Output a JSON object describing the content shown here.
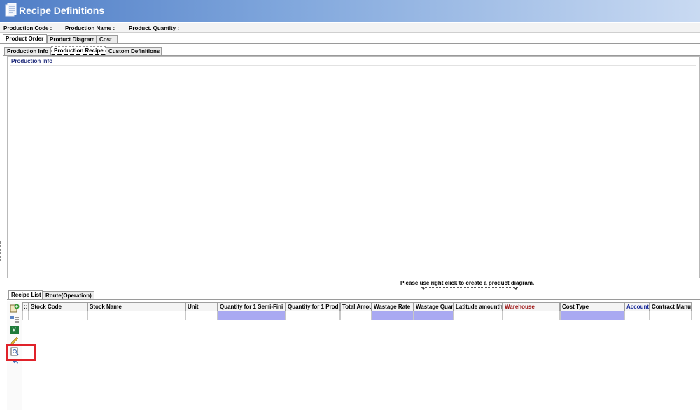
{
  "window": {
    "title": "Recipe Definitions"
  },
  "info_bar": {
    "production_code_label": "Production Code :",
    "production_name_label": "Production Name :",
    "production_quantity_label": "Product. Quantity :"
  },
  "main_tabs": [
    {
      "label": "Product Order",
      "active": true
    },
    {
      "label": "Product Diagram",
      "active": false
    },
    {
      "label": "Cost",
      "active": false
    }
  ],
  "sub_tabs": [
    {
      "label": "Production Info",
      "active": false
    },
    {
      "label": "Production Recipe",
      "active": true
    },
    {
      "label": "Custom Definitions",
      "active": false
    }
  ],
  "production_info": {
    "legend": "Production Info"
  },
  "diagram_hint": "Please use right click to create a product diagram.",
  "recipe_tabs": [
    {
      "label": "Recipe List",
      "active": true
    },
    {
      "label": "Route(Operation)",
      "active": false
    }
  ],
  "toolbar_icons": [
    "add-row-icon",
    "insert-row-icon",
    "excel-export-icon",
    "edit-icon",
    "search-document-icon",
    "undo-icon"
  ],
  "grid": {
    "row_header": "::",
    "columns": [
      {
        "label": "Stock Code",
        "style": "normal",
        "required": false
      },
      {
        "label": "Stock Name",
        "style": "normal",
        "required": false
      },
      {
        "label": "Unit",
        "style": "normal",
        "required": false
      },
      {
        "label": "Quantity for 1 Semi-Fini",
        "style": "normal",
        "required": true
      },
      {
        "label": "Quantity for 1 Prod",
        "style": "normal",
        "required": false
      },
      {
        "label": "Total Amou",
        "style": "normal",
        "required": false
      },
      {
        "label": "Wastage Rate",
        "style": "normal",
        "required": true
      },
      {
        "label": "Wastage Quar",
        "style": "normal",
        "required": true
      },
      {
        "label": "Latitude amounth",
        "style": "normal",
        "required": false
      },
      {
        "label": "Warehouse",
        "style": "red",
        "required": false
      },
      {
        "label": "Cost Type",
        "style": "normal",
        "required": true
      },
      {
        "label": "Account",
        "style": "blue",
        "required": false
      },
      {
        "label": "Contract Manu",
        "style": "normal",
        "required": false
      }
    ]
  },
  "colors": {
    "title_gradient_start": "#4f7dc6",
    "title_gradient_end": "#c9daf2",
    "required_cell": "#a9a9f2",
    "highlight_box": "#e0222a",
    "warehouse_header": "#9b1010",
    "account_header": "#1b2c9a"
  }
}
